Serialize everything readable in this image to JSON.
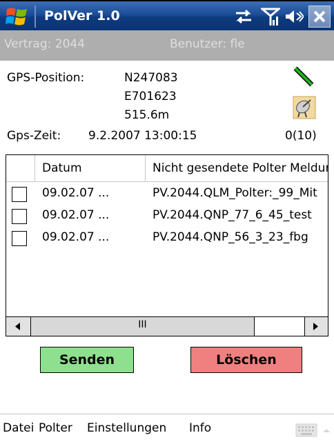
{
  "titlebar": {
    "title": "PolVer 1.0",
    "icons": [
      "windows-start-icon",
      "connectivity-icon",
      "signal-icon",
      "speaker-icon",
      "close-icon"
    ],
    "close_label": "✕"
  },
  "infobar": {
    "vertrag": "Vertrag:  2044",
    "benutzer": "Benutzer:  fle"
  },
  "gps": {
    "position_label": "GPS-Position:",
    "north": "N247083",
    "east": "E701623",
    "height": "515.6m",
    "time_label": "Gps-Zeit:",
    "time_value": "9.2.2007 13:00:15",
    "satellites": "0(10)"
  },
  "table": {
    "columns": [
      "",
      "Datum",
      "Nicht gesendete Polter Meldungen"
    ],
    "rows": [
      {
        "date": "09.02.07 ...",
        "message": "PV.2044.QLM_Polter:_99_Mit"
      },
      {
        "date": "09.02.07 ...",
        "message": "PV.2044.QNP_77_6_45_test"
      },
      {
        "date": "09.02.07 ...",
        "message": "PV.2044.QNP_56_3_23_fbg"
      }
    ],
    "scroll_thumb_label": "III"
  },
  "buttons": {
    "send": "Senden",
    "delete": "Löschen"
  },
  "menu": {
    "datei": "Datei",
    "polter": "Polter",
    "einstellungen": "Einstellungen",
    "info": "Info"
  },
  "colors": {
    "title_bar": "#1b4d97",
    "info_bar": "#aeaeae",
    "send_button": "#8ee08e",
    "delete_button": "#f08080"
  }
}
